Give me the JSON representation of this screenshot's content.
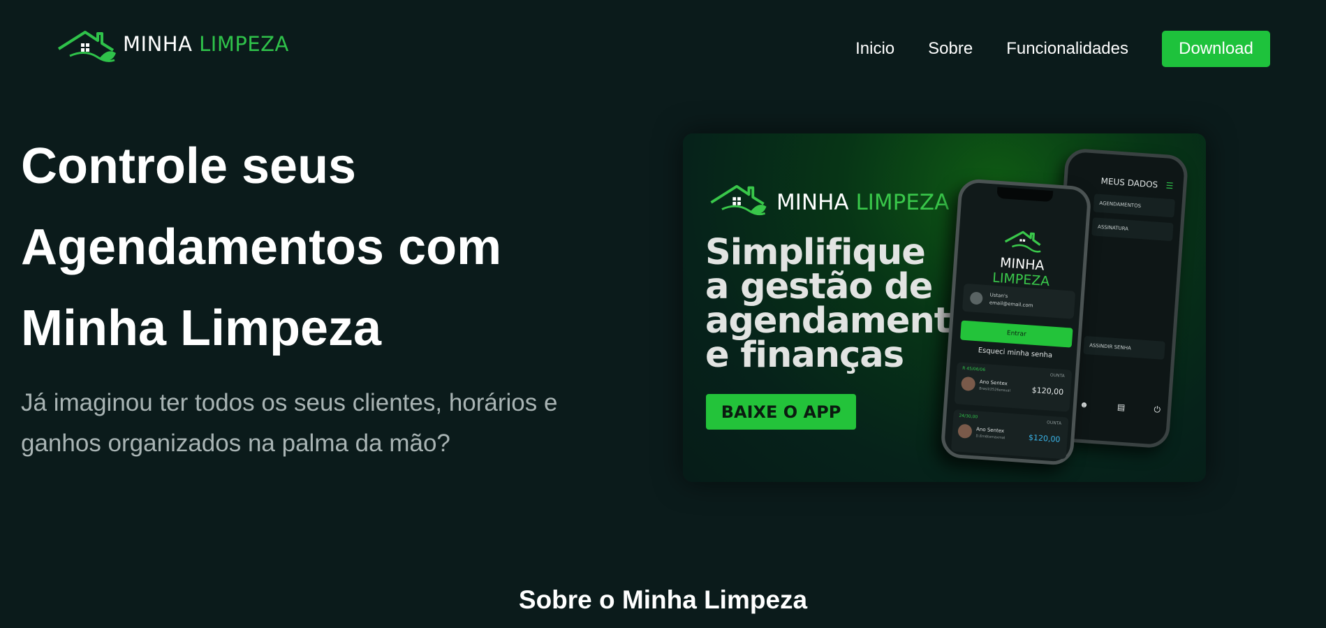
{
  "nav": {
    "logo_word1": "MINHA",
    "logo_word2": "LIMPEZA",
    "links": [
      "Inicio",
      "Sobre",
      "Funcionalidades"
    ],
    "download_label": "Download"
  },
  "hero": {
    "title_line1": "Controle seus",
    "title_line2": "Agendamentos com",
    "title_line3": "Minha Limpeza",
    "subtitle_line1": "Já imaginou ter todos os seus clientes, horários e",
    "subtitle_line2": "ganhos organizados na palma da mão?"
  },
  "banner": {
    "logo_word1": "MINHA",
    "logo_word2": "LIMPEZA",
    "heading_line1": "Simplifique",
    "heading_line2": "a gestão de",
    "heading_line3": "agendamentos",
    "heading_line4": "e finanças",
    "cta_label": "BAIXE O APP",
    "phone_back": {
      "title": "MEUS DADOS",
      "rows": [
        "AGENDAMENTOS",
        "ASSINATURA",
        "ASSINDIR SENHA"
      ]
    },
    "phone_front": {
      "logo_word1": "MINHA",
      "logo_word2": "LIMPEZA",
      "user_name": "Ustan's",
      "user_email": "email@email.com",
      "enter_label": "Entrar",
      "forgot_label": "Esqueci minha senha",
      "card1_tag": "R 45/06/06",
      "card1_name": "Ano Sentex",
      "card1_sub": "Brasil/2526ensual",
      "card1_count": "OUNTA",
      "card1_amount": "$120,00",
      "card2_tag": "24/30,00",
      "card2_name": "Ano Sentex",
      "card2_sub": "D.Em6tomaxmal",
      "card2_count": "OUNTA",
      "card2_amount": "$120,00"
    }
  },
  "section": {
    "title": "Sobre o Minha Limpeza"
  },
  "colors": {
    "background": "#0b1b1b",
    "accent_green": "#1ec23c",
    "subtitle_gray": "#a9b4b4"
  }
}
